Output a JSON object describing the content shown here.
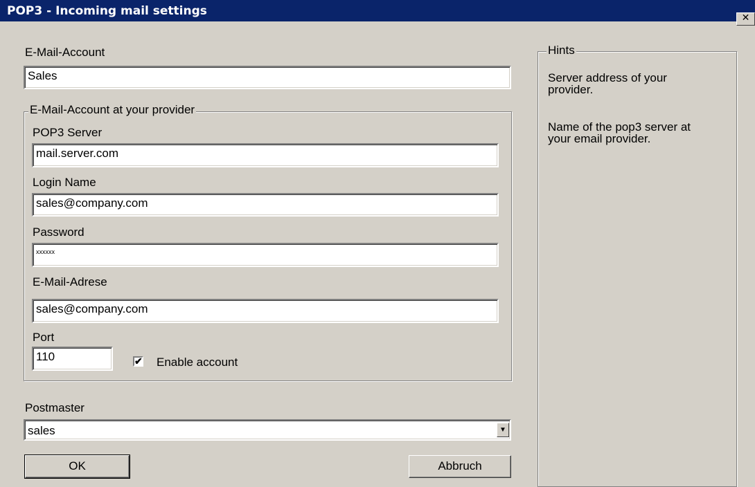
{
  "window": {
    "title": "POP3 - Incoming mail settings",
    "close_glyph": "✕"
  },
  "account": {
    "label": "E-Mail-Account",
    "value": "Sales"
  },
  "provider_group": {
    "legend": "E-Mail-Account at your provider",
    "pop3_server": {
      "label": "POP3 Server",
      "value": "mail.server.com"
    },
    "login_name": {
      "label": "Login Name",
      "value": "sales@company.com"
    },
    "password": {
      "label": "Password",
      "value": "xxxxxx"
    },
    "email_address": {
      "label": "E-Mail-Adrese",
      "value": "sales@company.com"
    },
    "port": {
      "label": "Port",
      "value": "110"
    },
    "enable_account": {
      "label": "Enable account",
      "checked": true,
      "check_glyph": "✔"
    }
  },
  "postmaster": {
    "label": "Postmaster",
    "selected": "sales",
    "arrow_glyph": "▼"
  },
  "buttons": {
    "ok": "OK",
    "cancel": "Abbruch"
  },
  "hints": {
    "legend": "Hints",
    "lines": [
      "Server address of your provider.",
      "Name of the pop3 server at your email provider."
    ]
  }
}
